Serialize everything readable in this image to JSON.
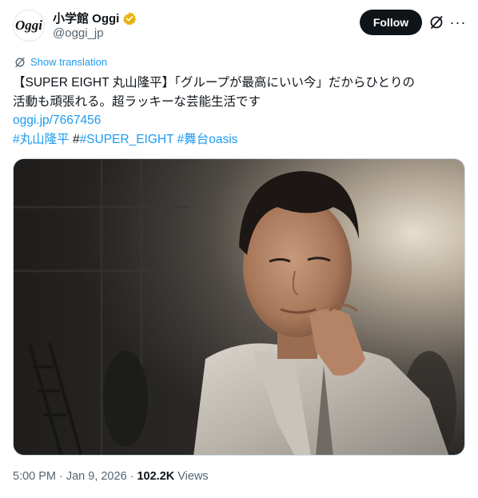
{
  "account": {
    "avatar_text": "Oggi",
    "display_name": "小学館 Oggi",
    "handle": "@oggi_jp",
    "verified_icon": "verified-badge-gold"
  },
  "actions": {
    "follow_label": "Follow",
    "grok_icon": "grok-icon",
    "more_label": "···"
  },
  "translation": {
    "label": "Show translation",
    "icon": "translate-icon"
  },
  "post": {
    "line1": "【SUPER EIGHT 丸山隆平】「グループが最高にいい今」だからひとりの",
    "line2": "活動も頑張れる。超ラッキーな芸能生活です",
    "link": "oggi.jp/7667456",
    "hashtag1": "#丸山隆平",
    "hash_plain": "#",
    "hashtag2": "#SUPER_EIGHT",
    "hashtag3": "#舞台oasis"
  },
  "meta": {
    "time": "5:00 PM",
    "sep1": "·",
    "date": "Jan 9, 2026",
    "sep2": "·",
    "views_count": "102.2K",
    "views_label": "Views"
  },
  "colors": {
    "link": "#1d9bf0",
    "follow_bg": "#0f1419",
    "muted": "#536471",
    "verified": "#e8b30b"
  }
}
